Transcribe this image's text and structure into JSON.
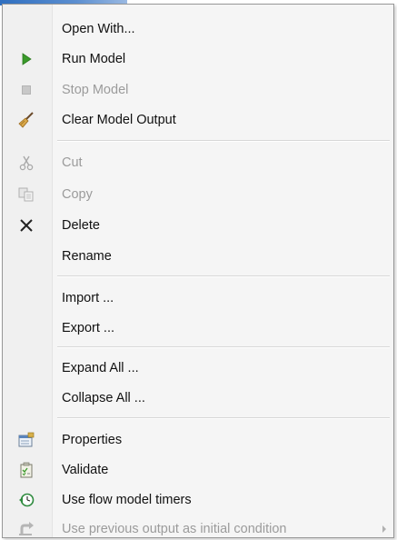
{
  "menu": {
    "groups": [
      [
        {
          "id": "open-with",
          "label": "Open With...",
          "enabled": true,
          "icon": "none"
        },
        {
          "id": "run-model",
          "label": "Run Model",
          "enabled": true,
          "icon": "play-icon"
        },
        {
          "id": "stop-model",
          "label": "Stop Model",
          "enabled": false,
          "icon": "stop-icon"
        },
        {
          "id": "clear-model-output",
          "label": "Clear Model Output",
          "enabled": true,
          "icon": "broom-icon"
        }
      ],
      [
        {
          "id": "cut",
          "label": "Cut",
          "enabled": false,
          "icon": "scissors-icon"
        },
        {
          "id": "copy",
          "label": "Copy",
          "enabled": false,
          "icon": "copy-icon"
        },
        {
          "id": "delete",
          "label": "Delete",
          "enabled": true,
          "icon": "delete-x-icon"
        },
        {
          "id": "rename",
          "label": "Rename",
          "enabled": true,
          "icon": "none"
        }
      ],
      [
        {
          "id": "import",
          "label": "Import ...",
          "enabled": true,
          "icon": "none"
        },
        {
          "id": "export",
          "label": "Export ...",
          "enabled": true,
          "icon": "none"
        }
      ],
      [
        {
          "id": "expand-all",
          "label": "Expand All ...",
          "enabled": true,
          "icon": "none"
        },
        {
          "id": "collapse-all",
          "label": "Collapse All ...",
          "enabled": true,
          "icon": "none"
        }
      ],
      [
        {
          "id": "properties",
          "label": "Properties",
          "enabled": true,
          "icon": "properties-icon"
        },
        {
          "id": "validate",
          "label": "Validate",
          "enabled": true,
          "icon": "clipboard-check-icon"
        },
        {
          "id": "use-flow-model-timers",
          "label": "Use flow model timers",
          "enabled": true,
          "icon": "clock-arrow-icon"
        },
        {
          "id": "use-previous-output",
          "label": "Use previous output as initial condition",
          "enabled": false,
          "icon": "return-arrow-icon",
          "submenu": true
        }
      ]
    ]
  },
  "colors": {
    "accent_green": "#3a9a2a",
    "disabled_text": "#9b9b9b",
    "separator": "#d7d7d7",
    "menu_bg": "#f5f5f5"
  }
}
